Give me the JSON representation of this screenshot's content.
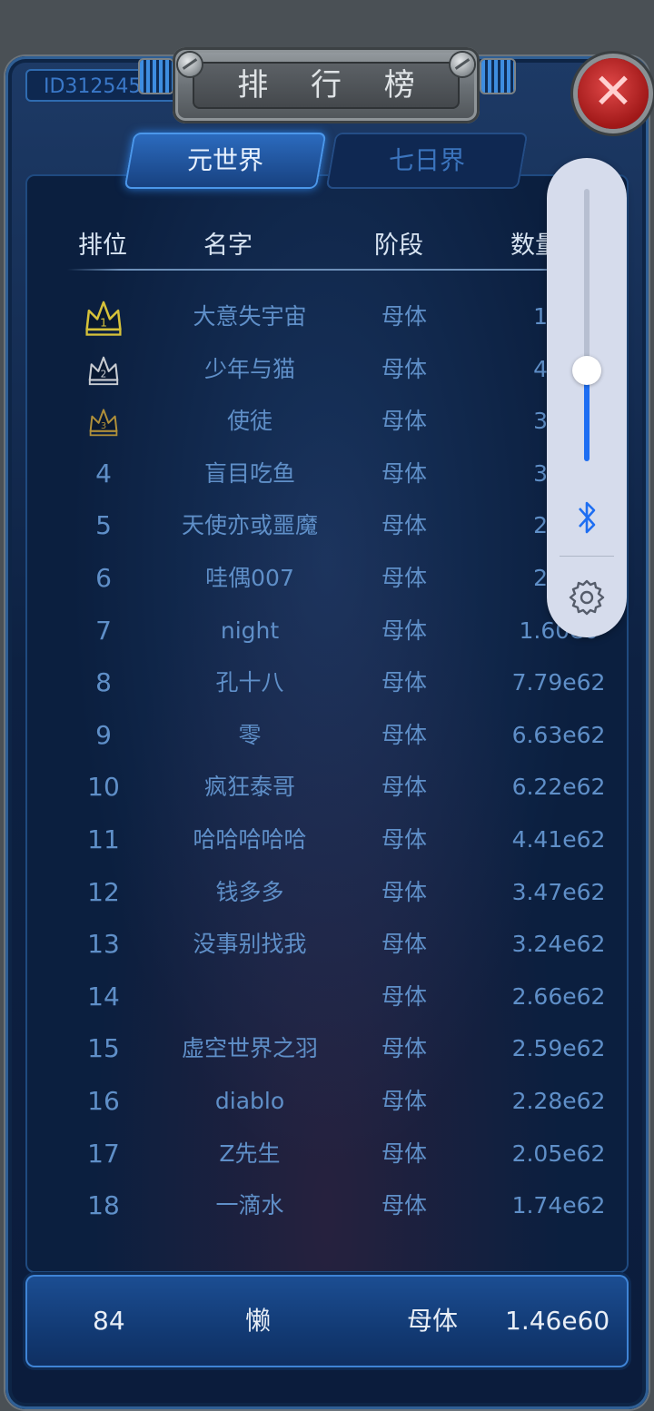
{
  "header": {
    "id_label": "ID3125459",
    "title": "排 行 榜",
    "close": "✕"
  },
  "tabs": [
    {
      "label": "元世界",
      "active": true
    },
    {
      "label": "七日界",
      "active": false
    }
  ],
  "table": {
    "headers": {
      "rank": "排位",
      "name": "名字",
      "stage": "阶段",
      "qty": "数量"
    },
    "rows": [
      {
        "rank": "1",
        "name": "大意失宇宙",
        "stage": "母体",
        "qty": "1.10"
      },
      {
        "rank": "2",
        "name": "少年与猫",
        "stage": "母体",
        "qty": "4.53"
      },
      {
        "rank": "3",
        "name": "使徒",
        "stage": "母体",
        "qty": "3.61"
      },
      {
        "rank": "4",
        "name": "盲目吃鱼",
        "stage": "母体",
        "qty": "3.11"
      },
      {
        "rank": "5",
        "name": "天使亦或噩魔",
        "stage": "母体",
        "qty": "2.19"
      },
      {
        "rank": "6",
        "name": "哇偶007",
        "stage": "母体",
        "qty": "2.02"
      },
      {
        "rank": "7",
        "name": "night",
        "stage": "母体",
        "qty": "1.60e6"
      },
      {
        "rank": "8",
        "name": "孔十八",
        "stage": "母体",
        "qty": "7.79e62"
      },
      {
        "rank": "9",
        "name": "零",
        "stage": "母体",
        "qty": "6.63e62"
      },
      {
        "rank": "10",
        "name": "疯狂泰哥",
        "stage": "母体",
        "qty": "6.22e62"
      },
      {
        "rank": "11",
        "name": "哈哈哈哈哈",
        "stage": "母体",
        "qty": "4.41e62"
      },
      {
        "rank": "12",
        "name": "钱多多",
        "stage": "母体",
        "qty": "3.47e62"
      },
      {
        "rank": "13",
        "name": "没事别找我",
        "stage": "母体",
        "qty": "3.24e62"
      },
      {
        "rank": "14",
        "name": "",
        "stage": "母体",
        "qty": "2.66e62"
      },
      {
        "rank": "15",
        "name": "虚空世界之羽",
        "stage": "母体",
        "qty": "2.59e62"
      },
      {
        "rank": "16",
        "name": "diablo",
        "stage": "母体",
        "qty": "2.28e62"
      },
      {
        "rank": "17",
        "name": "Z先生",
        "stage": "母体",
        "qty": "2.05e62"
      },
      {
        "rank": "18",
        "name": "一滴水",
        "stage": "母体",
        "qty": "1.74e62"
      }
    ]
  },
  "footer": {
    "rank": "84",
    "name": "懒",
    "stage": "母体",
    "qty": "1.46e60"
  },
  "volume_panel": {
    "level": 0.33
  },
  "colors": {
    "gold_crown": "#d6c23a",
    "silver_crown": "#c8ccd2",
    "bronze_crown": "#b0903a",
    "accent": "#1e6ef2"
  }
}
